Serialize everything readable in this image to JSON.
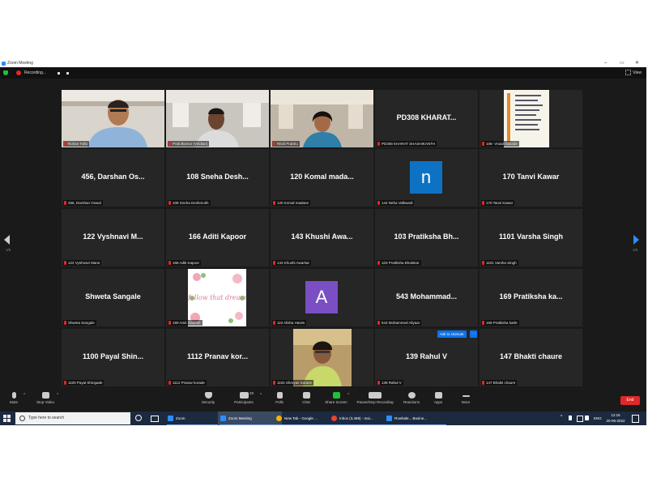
{
  "window": {
    "title": "Zoom Meeting"
  },
  "topbar": {
    "recording_label": "Recording...",
    "view_label": "View"
  },
  "navigation": {
    "page_left": "1/5",
    "page_right": "1/5"
  },
  "tiles": [
    {
      "kind": "video",
      "label": "Rohan Tullo"
    },
    {
      "kind": "video",
      "label": "Prafulkumar (Viridian)"
    },
    {
      "kind": "video",
      "label": "Ritoli Prabhu",
      "active": true
    },
    {
      "kind": "name",
      "name": "PD308  KHARAT...",
      "label": "PD308 KHARAT SHASHIKANTH"
    },
    {
      "kind": "screen",
      "label": "106- Vrutal Gavade"
    },
    {
      "kind": "name",
      "name": "456, Darshan Os...",
      "label": "456, Darshan Oswal"
    },
    {
      "kind": "name",
      "name": "108 Sneha Desh...",
      "label": "108 Sneha Deshmukh"
    },
    {
      "kind": "name",
      "name": "120 Komal mada...",
      "label": "120 Komal madane"
    },
    {
      "kind": "avatar",
      "initial": "n",
      "color": "#0e72c4",
      "label": "144 Neha Valkwadi"
    },
    {
      "kind": "name",
      "name": "170 Tanvi Kawar",
      "label": "170 Tanvi Kawar"
    },
    {
      "kind": "name",
      "name": "122 Vyshnavi M...",
      "label": "122 Vyshnavi Mane"
    },
    {
      "kind": "name",
      "name": "166 Aditi Kapoor",
      "label": "166 Aditi Kapoor"
    },
    {
      "kind": "name",
      "name": "143 Khushi Awa...",
      "label": "143 Khushi Awarkar"
    },
    {
      "kind": "name",
      "name": "103 Pratiksha Bh...",
      "label": "103 Pratiksha Bhalekar"
    },
    {
      "kind": "name",
      "name": "1101 Varsha Singh",
      "label": "1101 Varsha Singh"
    },
    {
      "kind": "name",
      "name": "Shweta Sangale",
      "label": "Shweta Sangale"
    },
    {
      "kind": "floral",
      "art_text": "follow that dream",
      "label": "190 Amit Ganesh"
    },
    {
      "kind": "avatar",
      "initial": "A",
      "color": "#7a4fc4",
      "label": "110 Alisha Hasim"
    },
    {
      "kind": "name",
      "name": "543  Mohammad...",
      "label": "543 Mohammed Aliyaar"
    },
    {
      "kind": "name",
      "name": "169 Pratiksha ka...",
      "label": "169 Pratiksha karle"
    },
    {
      "kind": "name",
      "name": "1100  Payal Shin...",
      "label": "1100  Payal Shingade"
    },
    {
      "kind": "name",
      "name": "1112 Pranav kor...",
      "label": "1112 Pranav korade"
    },
    {
      "kind": "video",
      "label": "1104 Shreyas Sutane"
    },
    {
      "kind": "name",
      "name": "139 Rahul V",
      "label": "139 Rahul V",
      "ask_unmute": "Ask to Unmute"
    },
    {
      "kind": "name",
      "name": "147 Bhakti chaure",
      "label": "147 Bhakti chaure"
    }
  ],
  "toolbar": {
    "mute": "Mute",
    "stop_video": "Stop Video",
    "security": "Security",
    "participants": "Participants",
    "participants_count": "29",
    "polls": "Polls",
    "chat": "Chat",
    "share_screen": "Share Screen",
    "pause_recording": "Pause/Stop Recording",
    "reactions": "Reactions",
    "apps": "Apps",
    "more": "More",
    "end": "End"
  },
  "taskbar": {
    "search_placeholder": "Type here to search",
    "items": [
      {
        "label": "Zoom",
        "color": "#2d8cff"
      },
      {
        "label": "Zoom Meeting",
        "color": "#2d8cff",
        "active": true
      },
      {
        "label": "New Tab - Google ...",
        "color": "#f4b400"
      },
      {
        "label": "Inbox (3,469) - mai...",
        "color": "#ea4335"
      },
      {
        "label": "Rowhale... Busine...",
        "color": "#2d8cff"
      }
    ],
    "lang": "ENG",
    "time": "12:16",
    "date": "20-05-2022"
  }
}
